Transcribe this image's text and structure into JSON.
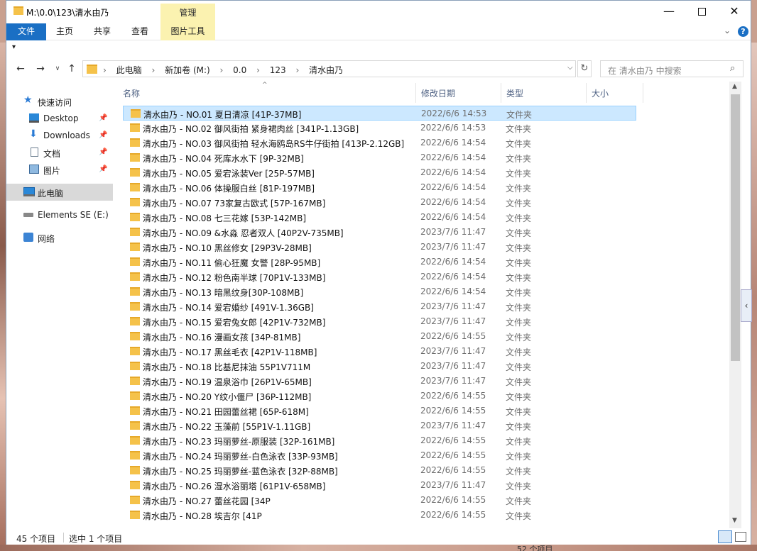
{
  "window": {
    "title": "M:\\0.0\\123\\清水由乃",
    "manage_tab": "管理",
    "controls": {
      "minimize": "—",
      "close": "✕"
    }
  },
  "ribbon": {
    "tabs": [
      "文件",
      "主页",
      "共享",
      "查看",
      "图片工具"
    ],
    "help": "?"
  },
  "address": {
    "crumbs": [
      "此电脑",
      "新加卷 (M:)",
      "0.0",
      "123",
      "清水由乃"
    ],
    "search_placeholder": "在 清水由乃 中搜索"
  },
  "navpane": {
    "items": [
      {
        "label": "快速访问",
        "icon": "star-icon"
      },
      {
        "label": "Desktop",
        "icon": "desktop-icon",
        "pinned": true
      },
      {
        "label": "Downloads",
        "icon": "downloads-icon",
        "pinned": true
      },
      {
        "label": "文档",
        "icon": "documents-icon",
        "pinned": true
      },
      {
        "label": "图片",
        "icon": "pictures-icon",
        "pinned": true
      },
      {
        "label": "此电脑",
        "icon": "this-pc-icon",
        "selected": true
      },
      {
        "label": "Elements SE (E:)",
        "icon": "drive-icon"
      },
      {
        "label": "网络",
        "icon": "network-icon"
      }
    ]
  },
  "columns": {
    "name": "名称",
    "date": "修改日期",
    "type": "类型",
    "size": "大小"
  },
  "files": [
    {
      "name": "清水由乃 - NO.01 夏日清凉 [41P-37MB]",
      "date": "2022/6/6 14:53",
      "type": "文件夹",
      "selected": true
    },
    {
      "name": "清水由乃 - NO.02 御风街拍 紧身裙肉丝 [341P-1.13GB]",
      "date": "2022/6/6 14:53",
      "type": "文件夹"
    },
    {
      "name": "清水由乃 - NO.03 御风街拍 轻水海鸥岛RS牛仔街拍 [413P-2.12GB]",
      "date": "2022/6/6 14:54",
      "type": "文件夹"
    },
    {
      "name": "清水由乃 - NO.04 死库水水下 [9P-32MB]",
      "date": "2022/6/6 14:54",
      "type": "文件夹"
    },
    {
      "name": "清水由乃 - NO.05 爱宕泳装Ver [25P-57MB]",
      "date": "2022/6/6 14:54",
      "type": "文件夹"
    },
    {
      "name": "清水由乃 - NO.06 体操服白丝 [81P-197MB]",
      "date": "2022/6/6 14:54",
      "type": "文件夹"
    },
    {
      "name": "清水由乃 - NO.07 73家复古欧式 [57P-167MB]",
      "date": "2022/6/6 14:54",
      "type": "文件夹"
    },
    {
      "name": "清水由乃 - NO.08 七三花嫁 [53P-142MB]",
      "date": "2022/6/6 14:54",
      "type": "文件夹"
    },
    {
      "name": "清水由乃 - NO.09 &水淼 忍者双人 [40P2V-735MB]",
      "date": "2023/7/6 11:47",
      "type": "文件夹"
    },
    {
      "name": "清水由乃 - NO.10 黑丝修女  [29P3V-28MB]",
      "date": "2023/7/6 11:47",
      "type": "文件夹"
    },
    {
      "name": "清水由乃 - NO.11 偷心狂魔 女警 [28P-95MB]",
      "date": "2022/6/6 14:54",
      "type": "文件夹"
    },
    {
      "name": "清水由乃 - NO.12 粉色南半球 [70P1V-133MB]",
      "date": "2022/6/6 14:54",
      "type": "文件夹"
    },
    {
      "name": "清水由乃 - NO.13 暗黑纹身[30P-108MB]",
      "date": "2022/6/6 14:54",
      "type": "文件夹"
    },
    {
      "name": "清水由乃 - NO.14 爱宕婚纱 [491V-1.36GB]",
      "date": "2023/7/6 11:47",
      "type": "文件夹"
    },
    {
      "name": "清水由乃 - NO.15 爱宕兔女郎 [42P1V-732MB]",
      "date": "2023/7/6 11:47",
      "type": "文件夹"
    },
    {
      "name": "清水由乃 - NO.16 漫画女孩 [34P-81MB]",
      "date": "2022/6/6 14:55",
      "type": "文件夹"
    },
    {
      "name": "清水由乃 - NO.17 黑丝毛衣 [42P1V-118MB]",
      "date": "2023/7/6 11:47",
      "type": "文件夹"
    },
    {
      "name": "清水由乃 - NO.18 比基尼抹油 55P1V711M",
      "date": "2023/7/6 11:47",
      "type": "文件夹"
    },
    {
      "name": "清水由乃 - NO.19 温泉浴巾 [26P1V-65MB]",
      "date": "2023/7/6 11:47",
      "type": "文件夹"
    },
    {
      "name": "清水由乃 - NO.20 Y纹小僵尸 [36P-112MB]",
      "date": "2022/6/6 14:55",
      "type": "文件夹"
    },
    {
      "name": "清水由乃 - NO.21 田园蕾丝裙 [65P-618M]",
      "date": "2022/6/6 14:55",
      "type": "文件夹"
    },
    {
      "name": "清水由乃 - NO.22 玉藻前 [55P1V-1.11GB]",
      "date": "2023/7/6 11:47",
      "type": "文件夹"
    },
    {
      "name": "清水由乃 - NO.23 玛丽萝丝-原服装 [32P-161MB]",
      "date": "2022/6/6 14:55",
      "type": "文件夹"
    },
    {
      "name": "清水由乃 - NO.24 玛丽萝丝-白色泳衣 [33P-93MB]",
      "date": "2022/6/6 14:55",
      "type": "文件夹"
    },
    {
      "name": "清水由乃 - NO.25 玛丽萝丝-蓝色泳衣 [32P-88MB]",
      "date": "2022/6/6 14:55",
      "type": "文件夹"
    },
    {
      "name": "清水由乃 - NO.26 湿水浴丽塔 [61P1V-658MB]",
      "date": "2023/7/6 11:47",
      "type": "文件夹"
    },
    {
      "name": "清水由乃 - NO.27 蕾丝花园 [34P",
      "date": "2022/6/6 14:55",
      "type": "文件夹"
    },
    {
      "name": "清水由乃 - NO.28 埃吉尔 [41P",
      "date": "2022/6/6 14:55",
      "type": "文件夹"
    }
  ],
  "status": {
    "count": "45 个项目",
    "selected": "选中 1 个项目"
  },
  "background_text": "52 个项目"
}
